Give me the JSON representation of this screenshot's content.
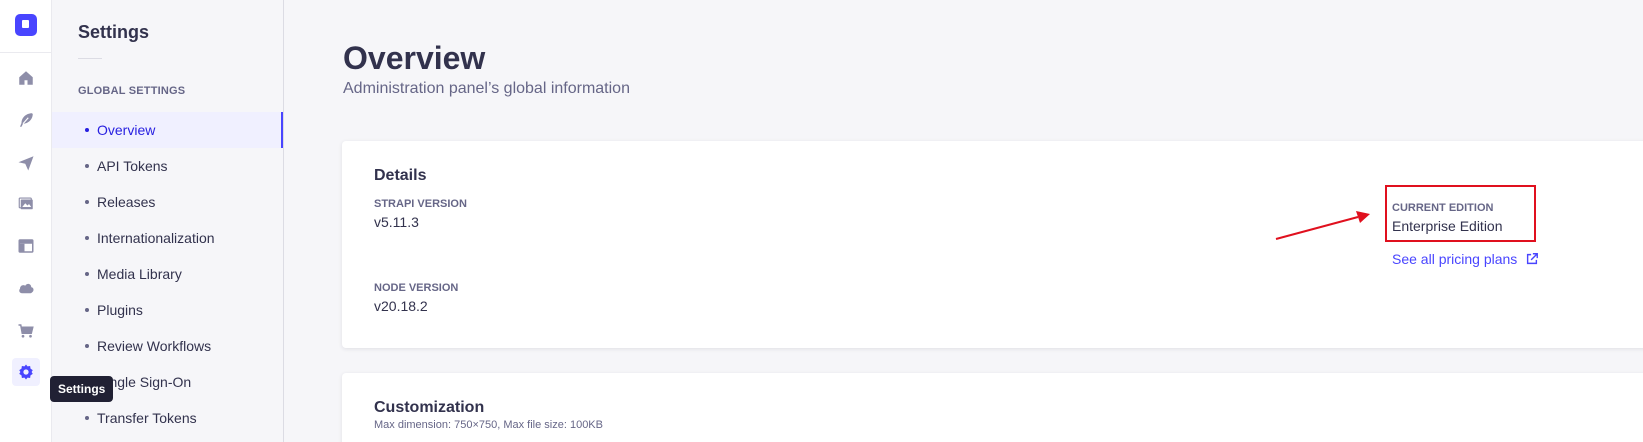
{
  "rail": {
    "tooltip": "Settings"
  },
  "subnav": {
    "title": "Settings",
    "section": "GLOBAL SETTINGS",
    "items": [
      {
        "label": "Overview"
      },
      {
        "label": "API Tokens"
      },
      {
        "label": "Releases"
      },
      {
        "label": "Internationalization"
      },
      {
        "label": "Media Library"
      },
      {
        "label": "Plugins"
      },
      {
        "label": "Review Workflows"
      },
      {
        "label": "Single Sign-On"
      },
      {
        "label": "Transfer Tokens"
      }
    ]
  },
  "main": {
    "title": "Overview",
    "subtitle": "Administration panel’s global information",
    "details": {
      "heading": "Details",
      "strapi_label": "STRAPI VERSION",
      "strapi_value": "v5.11.3",
      "node_label": "NODE VERSION",
      "node_value": "v20.18.2",
      "edition_label": "CURRENT EDITION",
      "edition_value": "Enterprise Edition",
      "pricing_link": "See all pricing plans"
    },
    "customization": {
      "heading": "Customization",
      "hint": "Max dimension: 750×750, Max file size: 100KB"
    }
  },
  "colors": {
    "primary": "#4945ff",
    "annotation": "#e0101e"
  }
}
